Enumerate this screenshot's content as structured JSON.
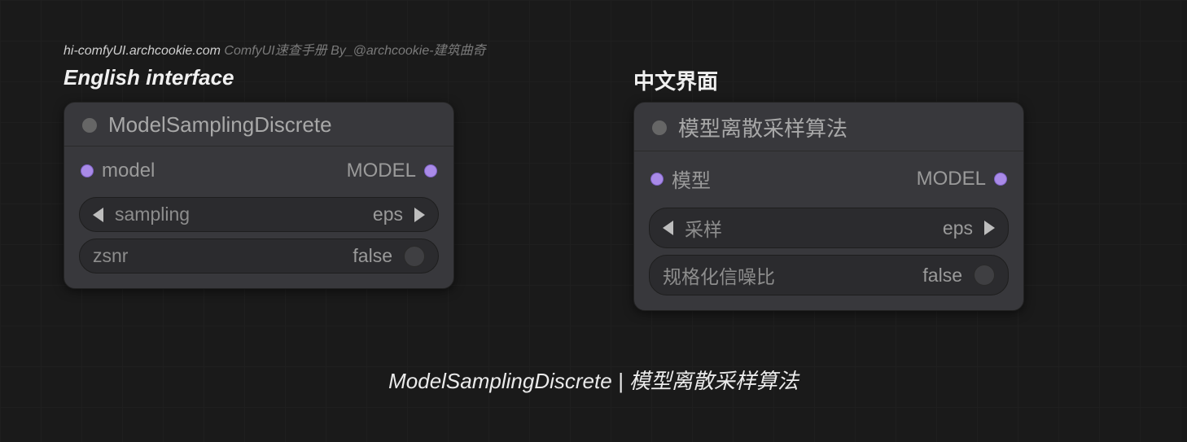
{
  "watermark": {
    "site": "hi-comfyUI.archcookie.com",
    "rest": " ComfyUI速查手册 By_@archcookie-建筑曲奇"
  },
  "labels": {
    "english": "English interface",
    "chinese": "中文界面"
  },
  "node_en": {
    "title": "ModelSamplingDiscrete",
    "input_label": "model",
    "output_label": "MODEL",
    "widgets": {
      "sampling": {
        "label": "sampling",
        "value": "eps"
      },
      "zsnr": {
        "label": "zsnr",
        "value": "false"
      }
    }
  },
  "node_zh": {
    "title": "模型离散采样算法",
    "input_label": "模型",
    "output_label": "MODEL",
    "widgets": {
      "sampling": {
        "label": "采样",
        "value": "eps"
      },
      "zsnr": {
        "label": "规格化信噪比",
        "value": "false"
      }
    }
  },
  "caption": "ModelSamplingDiscrete | 模型离散采样算法"
}
